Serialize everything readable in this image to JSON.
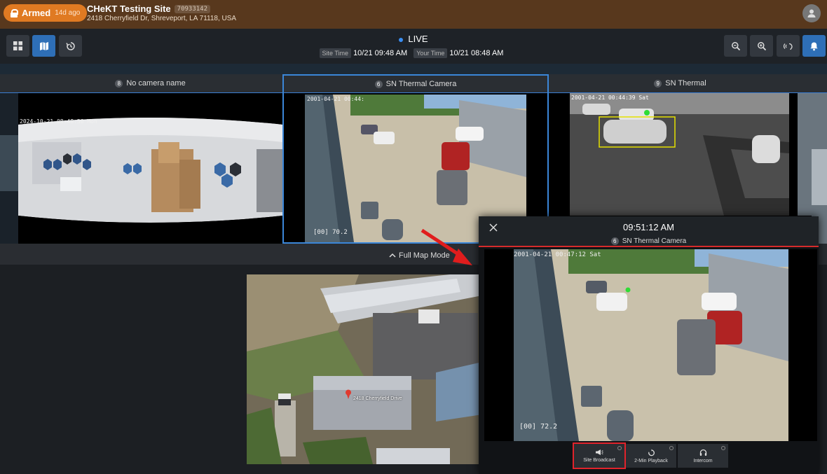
{
  "header": {
    "armed_label": "Armed",
    "armed_ago": "14d ago",
    "site_name": "CHeKT Testing Site",
    "site_code": "70933142",
    "site_address": "2418 Cherryfield Dr, Shreveport, LA 71118, USA",
    "profile_icon": "user-icon"
  },
  "toolbar": {
    "live_label": "LIVE",
    "site_time_label": "Site Time",
    "site_time": "10/21 09:48 AM",
    "your_time_label": "Your Time",
    "your_time": "10/21 08:48 AM",
    "left_buttons": [
      "grid-icon",
      "map-icon",
      "history-icon"
    ],
    "right_buttons": [
      "zoom-out-icon",
      "zoom-in-icon",
      "broadcast-icon",
      "bell-icon"
    ]
  },
  "cameras": [
    {
      "num": "8",
      "name": "No camera name",
      "osd": "2024-10-21 08:48:50 Mon"
    },
    {
      "num": "6",
      "name": "SN Thermal Camera",
      "osd": "2001-04-21 00:44:",
      "osd2": "[00] 70.2",
      "selected": true
    },
    {
      "num": "9",
      "name": "SN Thermal",
      "osd": "2001-04-21 00:44:39 Sat"
    }
  ],
  "fullmap": {
    "label": "Full Map Mode"
  },
  "map": {
    "place_label": "2418 Cherryfield Drive"
  },
  "popup": {
    "clock": "09:51:12 AM",
    "cam_num": "6",
    "cam_name": "SN Thermal Camera",
    "osd": "2001-04-21 00:47:12 Sat",
    "osd2": "[00] 72.2",
    "buttons": [
      {
        "label": "Site Broadcast",
        "icon": "megaphone-icon",
        "highlighted": true
      },
      {
        "label": "2-Min Playback",
        "icon": "replay-icon",
        "highlighted": false
      },
      {
        "label": "Intercom",
        "icon": "headset-icon",
        "highlighted": false
      }
    ]
  },
  "colors": {
    "header_bg": "#58381d",
    "armed": "#e07a22",
    "accent": "#2e6fb7",
    "alert": "#d62b2b"
  }
}
